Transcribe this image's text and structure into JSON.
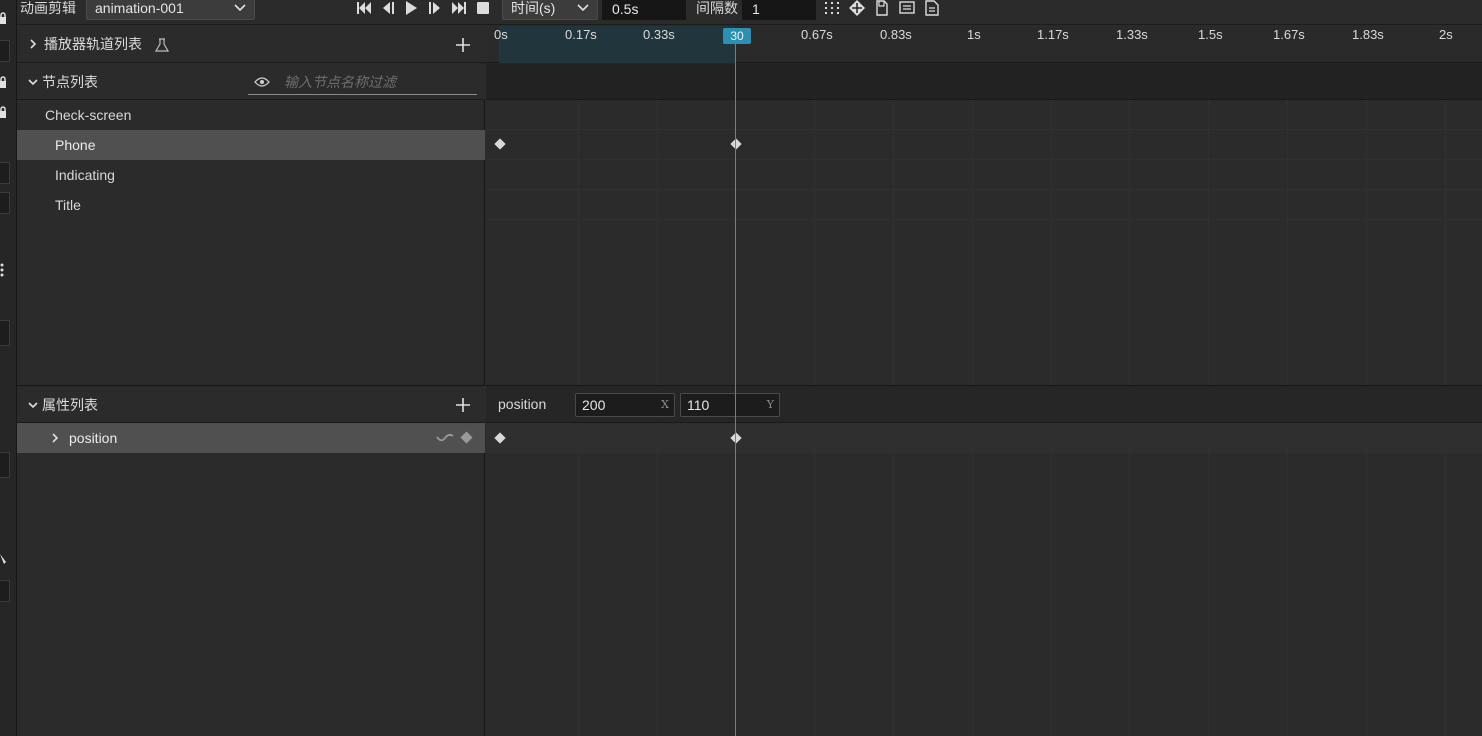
{
  "toolbar": {
    "clip_label": "动画剪辑",
    "clip_select": "animation-001",
    "time_mode": "时间(s)",
    "current_time": "0.5s",
    "interval_label": "间隔数",
    "interval_value": "1"
  },
  "player_tracks": {
    "title": "播放器轨道列表"
  },
  "node_list": {
    "title": "节点列表",
    "filter_placeholder": "输入节点名称过滤",
    "nodes": [
      {
        "label": "Check-screen",
        "selected": false
      },
      {
        "label": "Phone",
        "selected": true
      },
      {
        "label": "Indicating",
        "selected": false
      },
      {
        "label": "Title",
        "selected": false
      }
    ]
  },
  "property_list": {
    "title": "属性列表",
    "properties": [
      {
        "label": "position"
      }
    ]
  },
  "property_editor": {
    "name": "position",
    "x": "200",
    "x_axis": "X",
    "y": "110",
    "y_axis": "Y"
  },
  "timeline": {
    "ticks": [
      "0s",
      "0.17s",
      "0.33s",
      "0.67s",
      "0.83s",
      "1s",
      "1.17s",
      "1.33s",
      "1.5s",
      "1.67s",
      "1.83s",
      "2s"
    ],
    "cursor_frame": "30"
  },
  "colors": {
    "background": "#2b2b2b",
    "accent": "#3794b6",
    "selection": "#505050",
    "keyframe": "#d9d9d9"
  }
}
